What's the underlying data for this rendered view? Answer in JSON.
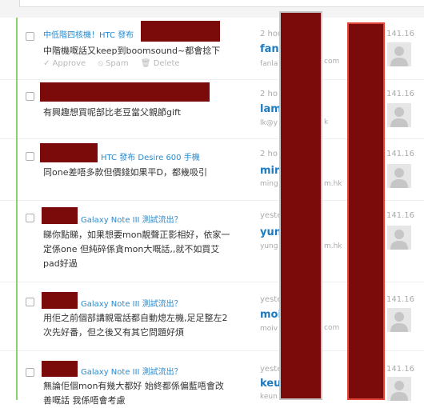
{
  "comments": [
    {
      "title": "中低階四核機！HTC 發布",
      "body": "中階機嘅話又keep到boomsound~都會捻下",
      "actions": [
        "✓ Approve",
        "⦸ Spam",
        "🗑 Delete"
      ],
      "time": "2 hou",
      "author": "fanl",
      "email": "fanla",
      "email_tail": "com",
      "ip": "141.16"
    },
    {
      "title": "",
      "body": "有興趣想買呢部比老豆當父親節gift",
      "time": "2 ho",
      "author": "lam",
      "email": "lk@y",
      "email_tail": "k",
      "ip": "141.16"
    },
    {
      "title": "HTC 發布 Desire 600 手機",
      "body": "同one差唔多款但價錢如果平D，都幾吸引",
      "time": "2 ho",
      "author": "min",
      "email": "ming",
      "email_tail": "m.hk",
      "ip": "141.16"
    },
    {
      "title": "Galaxy Note III 測試流出？",
      "body": "睇你點睇，如果想要mon靚聲正影相好，依家一\n定係one 但純碎係貪mon大嘅話,,就不如買艾\npad好過",
      "time": "yeste",
      "author": "yun",
      "email": "yung",
      "email_tail": "m.hk",
      "ip": "141.16"
    },
    {
      "title": "Galaxy Note III 測試流出？",
      "body": "用佢之前個部講親電話都自動熄左機,足足整左2\n次先好番，但之後又有其它問題好煩",
      "time": "yeste",
      "author": "moi",
      "email": "moiv",
      "email_tail": "com",
      "ip": "141.16"
    },
    {
      "title": "Galaxy Note III 測試流出？",
      "body": "無論佢個mon有幾大都好 始終都係偏藍唔會改\n善嘅話 我係唔會考慮",
      "time": "yeste",
      "author": "keu",
      "email": "keun",
      "email_tail": "",
      "ip": "141.16"
    }
  ]
}
